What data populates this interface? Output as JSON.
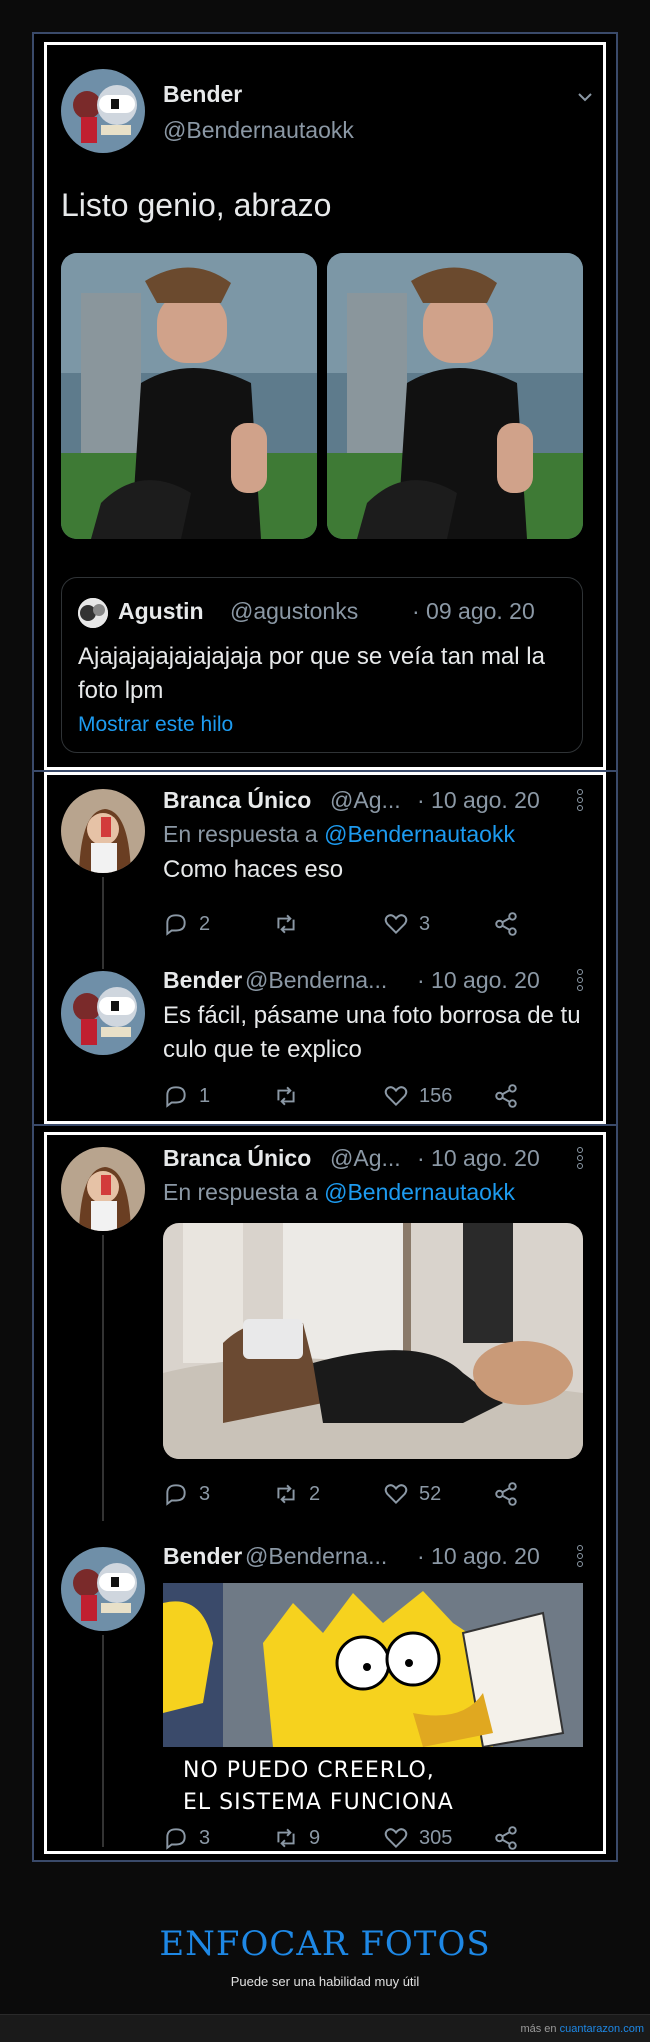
{
  "tweet1": {
    "name": "Bender",
    "handle": "@Bendernautaokk",
    "text": "Listo genio, abrazo",
    "quote": {
      "name": "Agustin",
      "handle": "@agustonks",
      "date": "· 09 ago. 20",
      "text": "Ajajajajajajajajaja por que se veía tan mal la foto lpm",
      "link": "Mostrar este hilo"
    }
  },
  "panel2": {
    "reply1": {
      "name": "Branca Único",
      "handle": "@Ag...",
      "date": "· 10 ago. 20",
      "reply_prefix": "En respuesta a",
      "reply_to": "@Bendernautaokk",
      "text": "Como haces eso",
      "replies": "2",
      "retweets": "",
      "likes": "3"
    },
    "reply2": {
      "name": "Bender",
      "handle": "@Benderna...",
      "date": "· 10 ago. 20",
      "text": "Es fácil, pásame una foto borrosa de tu culo que te explico",
      "replies": "1",
      "retweets": "",
      "likes": "156"
    }
  },
  "panel3": {
    "reply1": {
      "name": "Branca Único",
      "handle": "@Ag...",
      "date": "· 10 ago. 20",
      "reply_prefix": "En respuesta a",
      "reply_to": "@Bendernautaokk",
      "replies": "3",
      "retweets": "2",
      "likes": "52"
    },
    "reply2": {
      "name": "Bender",
      "handle": "@Benderna...",
      "date": "· 10 ago. 20",
      "meme_line1": "NO PUEDO CREERLO,",
      "meme_line2": "EL SISTEMA FUNCIONA",
      "replies": "3",
      "retweets": "9",
      "likes": "305"
    }
  },
  "footer": {
    "title": "ENFOCAR FOTOS",
    "subtitle": "Puede ser una habilidad muy útil",
    "credit_prefix": "más en",
    "credit_site": "cuantarazon.com"
  },
  "colors": {
    "accent": "#1d9bf0",
    "title": "#1e88e5",
    "muted": "#8b98a5"
  },
  "icons": [
    "reply-icon",
    "retweet-icon",
    "like-icon",
    "share-icon",
    "chevron-down-icon",
    "more-vertical-icon"
  ]
}
